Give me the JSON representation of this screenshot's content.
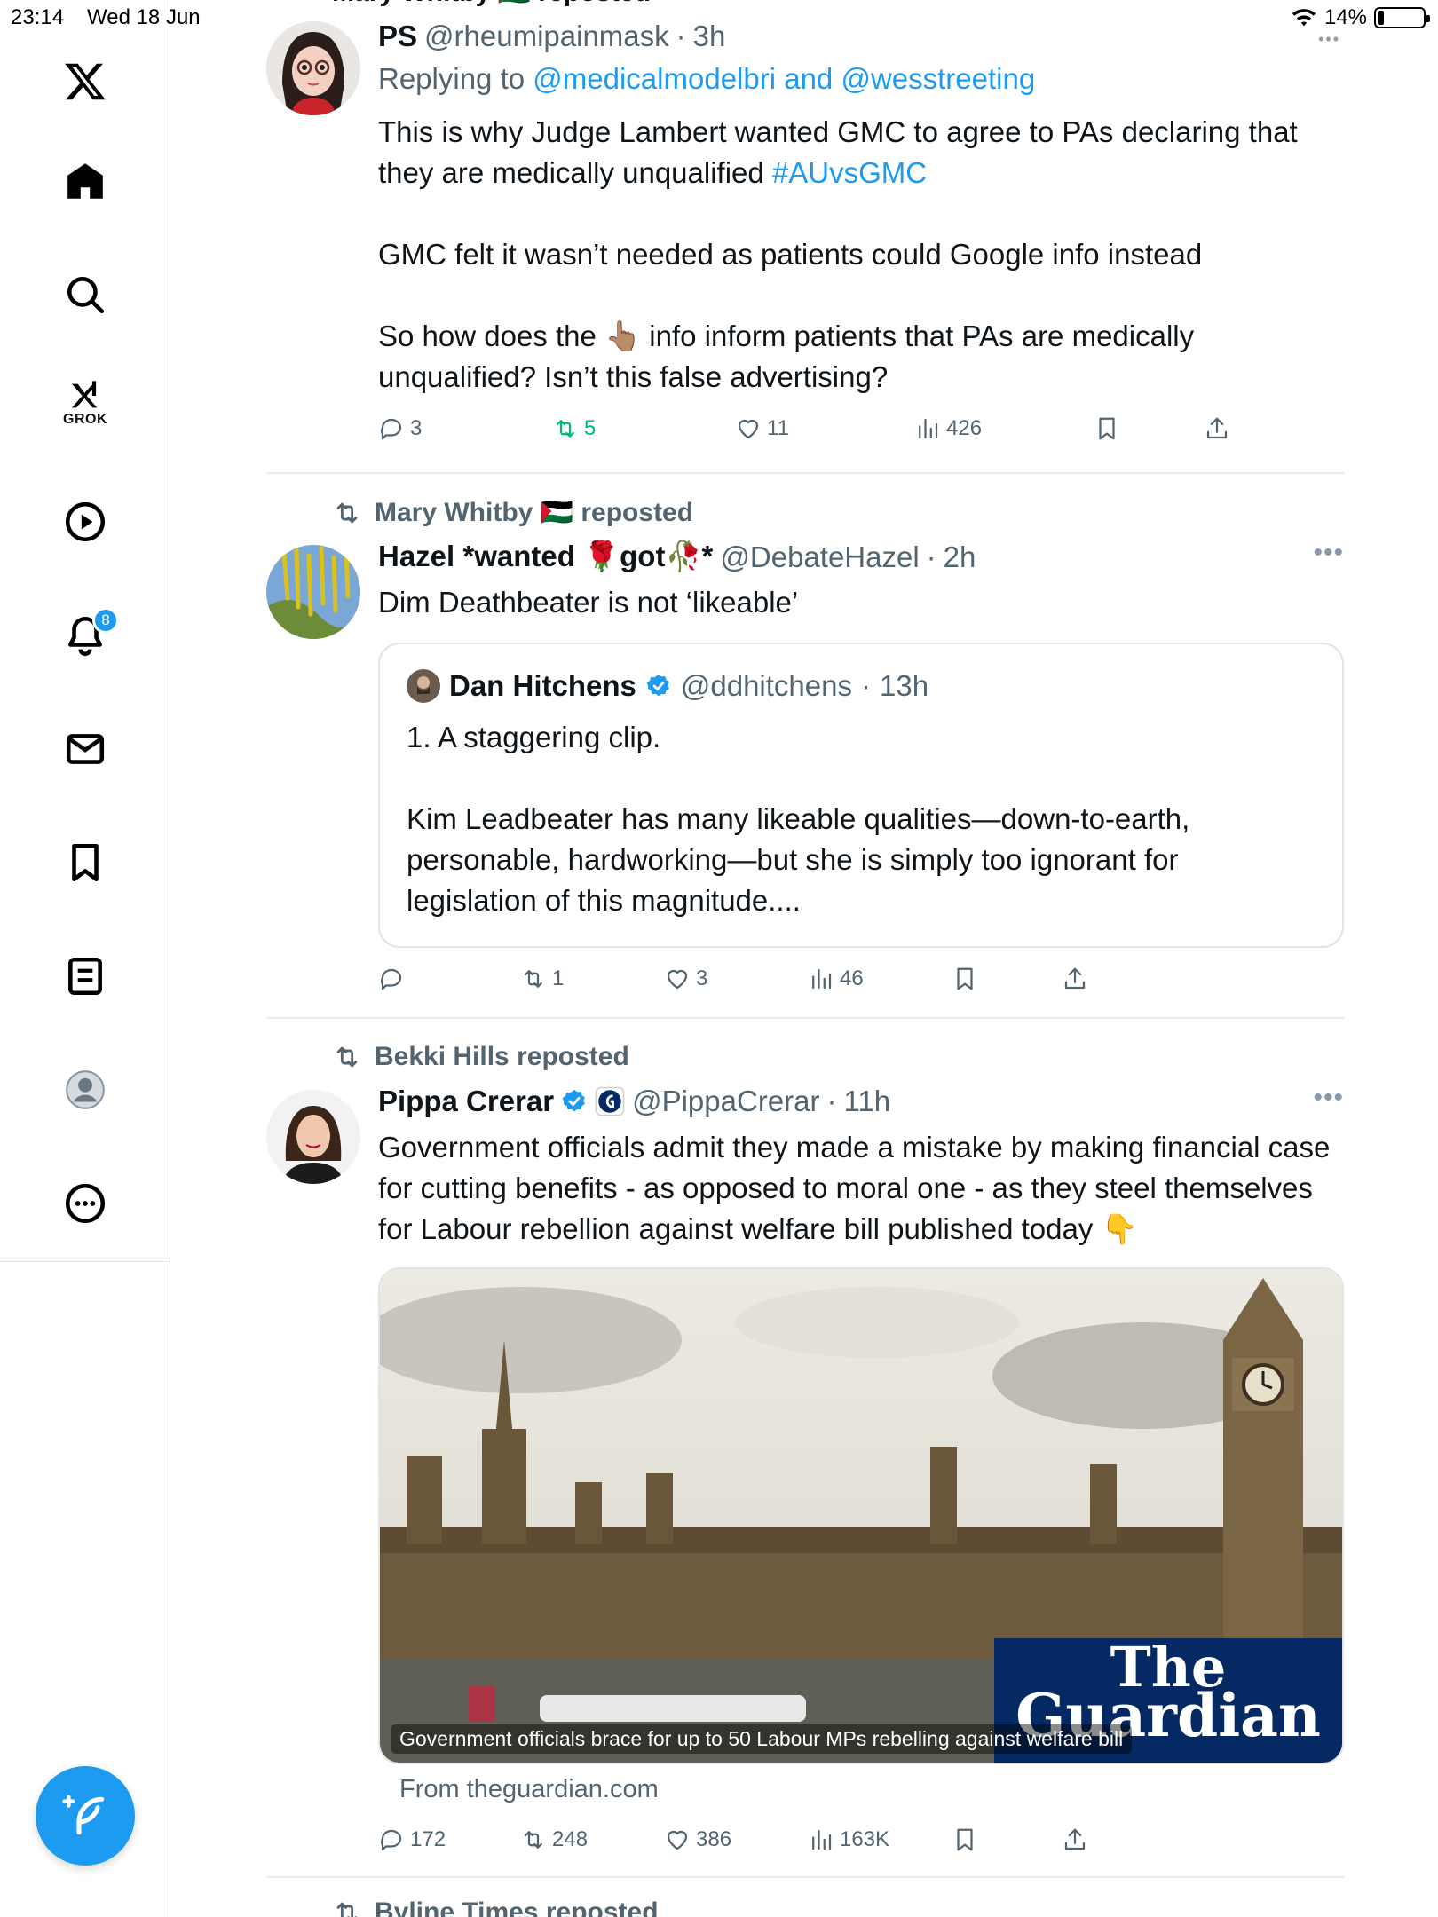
{
  "status_bar": {
    "time": "23:14",
    "date": "Wed 18 Jun",
    "battery": "14%",
    "battery_level": 0.14
  },
  "sidebar": {
    "items": [
      {
        "name": "x-logo-icon"
      },
      {
        "name": "home-icon"
      },
      {
        "name": "search-icon"
      },
      {
        "name": "grok-icon",
        "label": "GROK"
      },
      {
        "name": "video-icon"
      },
      {
        "name": "notifications-icon",
        "badge": "8"
      },
      {
        "name": "messages-icon"
      },
      {
        "name": "bookmarks-icon"
      },
      {
        "name": "lists-icon"
      },
      {
        "name": "profile-icon"
      },
      {
        "name": "more-icon"
      }
    ]
  },
  "top_partial": {
    "repost_line": "Mary Whitby 🇵🇸 reposted"
  },
  "posts": [
    {
      "name": "PS",
      "handle": "@rheumipainmask",
      "time": "3h",
      "more": "•••",
      "replying_prefix": "Replying to",
      "replying_to": "@medicalmodelbri and @wesstreeting",
      "text1": "This is why Judge Lambert wanted GMC to agree to PAs declaring that they are medically unqualified",
      "hashtag": "#AUvsGMC",
      "text2": "GMC felt it wasn’t needed as patients could Google info instead",
      "text3a": "So how does the",
      "emoji_pointer": "👆🏽",
      "text3b": "info inform patients that PAs are medically unqualified? Isn’t this false advertising?",
      "replies": "3",
      "reposts": "5",
      "likes": "11",
      "views": "426"
    },
    {
      "repost_line": "Mary Whitby 🇵🇸 reposted",
      "name": "Hazel *wanted 🌹got🥀*",
      "handle": "@DebateHazel",
      "time": "2h",
      "more": "•••",
      "text": "Dim Deathbeater is not ‘likeable’",
      "quote": {
        "name": "Dan Hitchens",
        "handle": "@ddhitchens",
        "time": "13h",
        "text1": "1. A staggering clip.",
        "text2": "Kim Leadbeater has many likeable qualities—down-to-earth, personable, hardworking—but she is simply too ignorant for legislation of this magnitude...."
      },
      "replies": "",
      "reposts": "1",
      "likes": "3",
      "views": "46"
    },
    {
      "repost_line": "Bekki Hills reposted",
      "name": "Pippa Crerar",
      "handle": "@PippaCrerar",
      "time": "11h",
      "more": "•••",
      "text": "Government officials admit they made a mistake by making financial case for cutting benefits - as opposed to moral one - as they steel themselves for Labour rebellion against welfare bill published today",
      "emoji": "👇",
      "media_caption": "Government officials brace for up to 50 Labour MPs rebelling against welfare bill",
      "media_brand_line1": "The",
      "media_brand_line2": "Guardian",
      "source": "From theguardian.com",
      "replies": "172",
      "reposts": "248",
      "likes": "386",
      "views": "163K"
    }
  ],
  "bottom_partial": {
    "repost_line": "Byline Times reposted"
  },
  "colors": {
    "accent": "#1d9bf0",
    "repost_green": "#00ba7c",
    "muted": "#536471",
    "guardian_blue": "#052962"
  }
}
